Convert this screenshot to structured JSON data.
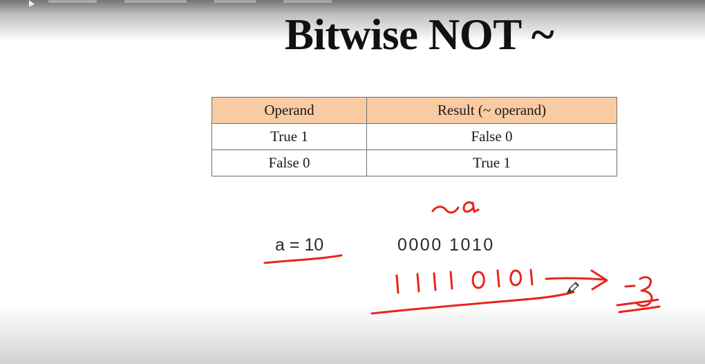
{
  "slide": {
    "title": "Bitwise NOT ~"
  },
  "truth_table": {
    "headers": [
      "Operand",
      "Result (~ operand)"
    ],
    "rows": [
      [
        "True 1",
        "False 0"
      ],
      [
        "False 0",
        "True 1"
      ]
    ],
    "header_color": "#f9cba3"
  },
  "example": {
    "expression": "a = 10",
    "binary": "0000 1010"
  },
  "annotations": {
    "ink_color": "#e8241c",
    "tilde_a": "~a",
    "inverted_binary": "1111 0101",
    "result": "-3"
  }
}
